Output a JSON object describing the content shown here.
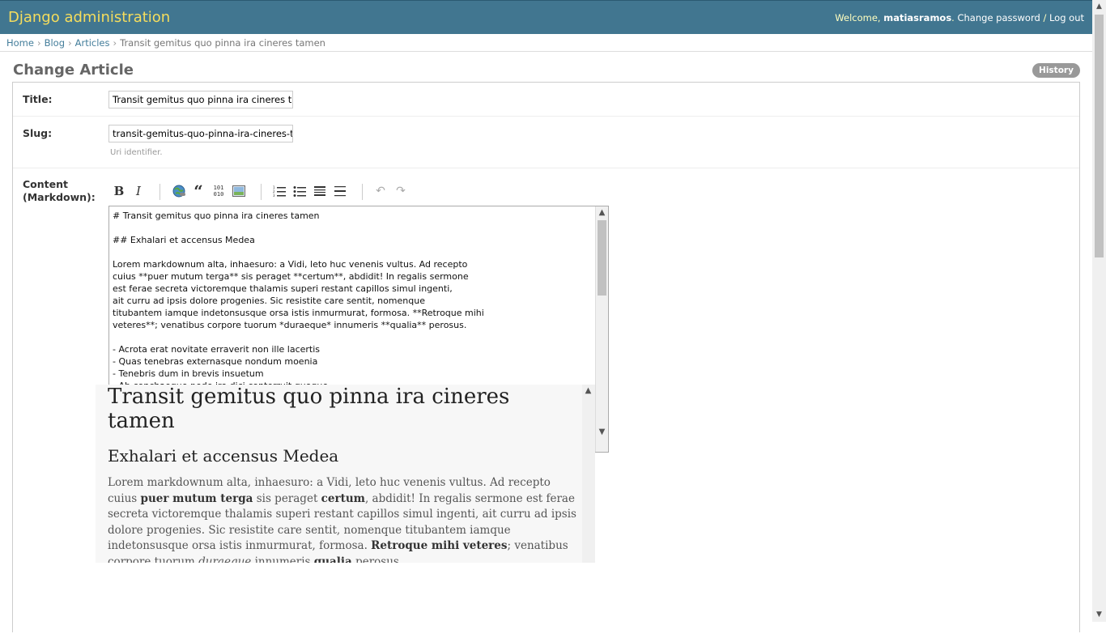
{
  "header": {
    "brand": "Django administration",
    "welcome": "Welcome,",
    "username": "matiasramos",
    "change_password": "Change password",
    "separator": "/",
    "logout": "Log out"
  },
  "breadcrumbs": {
    "home": "Home",
    "app": "Blog",
    "model": "Articles",
    "current": "Transit gemitus quo pinna ira cineres tamen",
    "sep": "›"
  },
  "page": {
    "title": "Change Article",
    "history_button": "History"
  },
  "form": {
    "title_label": "Title:",
    "title_value": "Transit gemitus quo pinna ira cineres tamen",
    "slug_label": "Slug:",
    "slug_value": "transit-gemitus-quo-pinna-ira-cineres-tamen",
    "slug_help": "Uri identifier.",
    "content_label_line1": "Content",
    "content_label_line2": "(Markdown):",
    "toolbar": {
      "bold": "B",
      "italic": "I",
      "link_icon": "globe-link-icon",
      "quote": "“",
      "code": "101",
      "image_icon": "image-icon",
      "ordered_list_icon": "ordered-list-icon",
      "unordered_list_icon": "unordered-list-icon",
      "heading_icon": "heading-icon",
      "hr_icon": "horizontal-rule-icon",
      "undo": "↶",
      "redo": "↷"
    },
    "content_text": "# Transit gemitus quo pinna ira cineres tamen\n\n## Exhalari et accensus Medea\n\nLorem markdownum alta, inhaesuro: a Vidi, leto huc venenis vultus. Ad recepto\ncuius **puer mutum terga** sis peraget **certum**, abdidit! In regalis sermone\nest ferae secreta victoremque thalamis superi restant capillos simul ingenti,\nait curru ad ipsis dolore progenies. Sic resistite care sentit, nomenque\ntitubantem iamque indetonsusque orsa istis inmurmurat, formosa. **Retroque mihi\nveteres**; venatibus corpore tuorum *duraeque* innumeris **qualia** perosus.\n\n- Acrota erat novitate erraverit non ille lacertis\n- Quas tenebras externasque nondum moenia\n- Tenebris dum in brevis insuetum\n- Ab conchaeque pede ire dici conterruit quoque\n- Natam condar nomen Latini\n- Periit cibus amicos moderator terras\n\n## Fine ullo oculos ad natae aequantur nec"
  },
  "preview": {
    "h1": "Transit gemitus quo pinna ira cineres tamen",
    "h2": "Exhalari et accensus Medea",
    "p1_a": "Lorem markdownum alta, inhaesuro: a Vidi, leto huc venenis vultus. Ad recepto cuius ",
    "p1_b1": "puer mutum terga",
    "p1_c": " sis peraget ",
    "p1_b2": "certum",
    "p1_d": ", abdidit! In regalis sermone est ferae secreta victoremque thalamis superi restant capillos simul ingenti, ait curru ad ipsis dolore progenies. Sic resistite care sentit, nomenque titubantem iamque indetonsusque orsa istis inmurmurat, formosa. ",
    "p1_b3": "Retroque mihi veteres",
    "p1_e": "; venatibus corpore tuorum ",
    "p1_i": "duraeque",
    "p1_f": " innumeris ",
    "p1_b4": "qualia",
    "p1_g": " perosus."
  }
}
